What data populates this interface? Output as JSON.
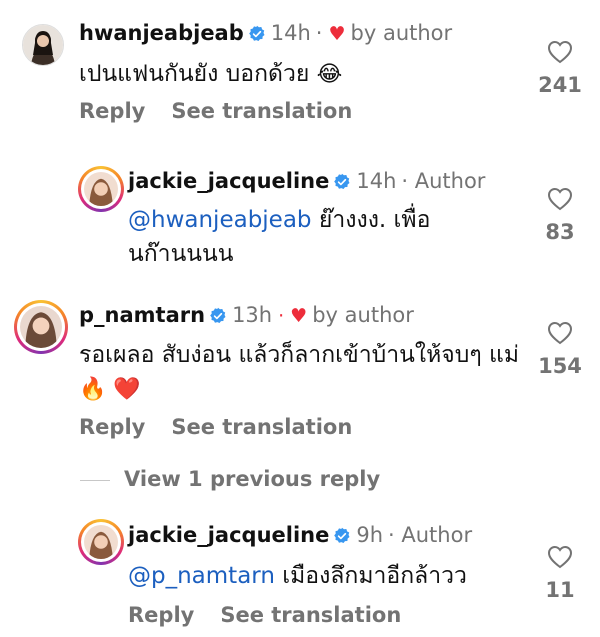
{
  "comments": [
    {
      "username": "hwanjeabjeab",
      "time": "14h",
      "meta_sep": "·",
      "liked_by": "by author",
      "text": "เปนแฟนกันยัง บอกด้วย",
      "text_emoji": "😂",
      "actions": [
        "Reply",
        "See translation"
      ],
      "likes": "241"
    },
    {
      "username": "jackie_jacqueline",
      "time": "14h",
      "author_label": "· Author",
      "mention": "@hwanjeabjeab",
      "text": " ย๊างงง. เพื่อ นก๊านนนน",
      "likes": "83"
    },
    {
      "username": "p_namtarn",
      "time": "13h",
      "liked_by": "by author",
      "text": "รอเผลอ สับง่อน แล้วก็ลากเข้าบ้านให้จบๆ แม่",
      "text_emoji": "🔥 ❤️",
      "actions": [
        "Reply",
        "See translation"
      ],
      "likes": "154"
    },
    {
      "username": "jackie_jacqueline",
      "time": "9h",
      "author_label": "· Author",
      "mention": "@p_namtarn",
      "text": "  เมืองลึกมาอีกล้าวว",
      "actions": [
        "Reply",
        "See translation"
      ],
      "likes": "11"
    }
  ],
  "view_previous": "View 1 previous reply",
  "colors": {
    "link": "#1c5fbf",
    "muted": "#737373",
    "heart": "#ed2d3b",
    "verified": "#3897f0"
  }
}
